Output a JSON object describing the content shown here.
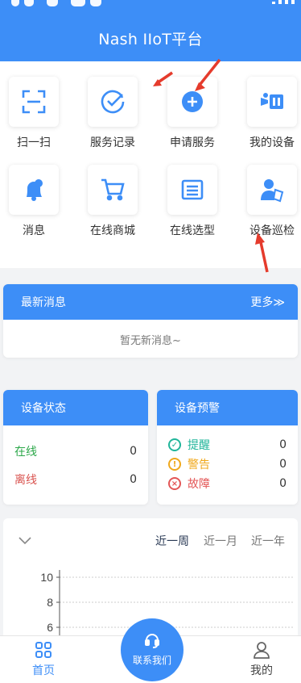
{
  "header": {
    "title": "Nash IIoT平台"
  },
  "colors": {
    "primary": "#3d8ef7",
    "online": "#2ca84a",
    "offline": "#d9534f",
    "remind": "#20b59a",
    "warn": "#f0a81c",
    "fault": "#e35656"
  },
  "quick_actions": [
    {
      "label": "扫一扫",
      "icon": "scan-icon"
    },
    {
      "label": "服务记录",
      "icon": "check-circle-icon"
    },
    {
      "label": "申请服务",
      "icon": "plus-circle-icon"
    },
    {
      "label": "我的设备",
      "icon": "camera-icon"
    },
    {
      "label": "消息",
      "icon": "bell-icon"
    },
    {
      "label": "在线商城",
      "icon": "cart-icon"
    },
    {
      "label": "在线选型",
      "icon": "list-icon"
    },
    {
      "label": "设备巡检",
      "icon": "inspector-icon"
    }
  ],
  "messages": {
    "title": "最新消息",
    "more": "更多≫",
    "empty": "暂无新消息~"
  },
  "device_status": {
    "title": "设备状态",
    "online_label": "在线",
    "online_value": "0",
    "offline_label": "离线",
    "offline_value": "0"
  },
  "device_alert": {
    "title": "设备预警",
    "remind_label": "提醒",
    "remind_value": "0",
    "warn_label": "警告",
    "warn_value": "0",
    "fault_label": "故障",
    "fault_value": "0"
  },
  "chart": {
    "tabs": [
      "近一周",
      "近一月",
      "近一年"
    ],
    "active_tab": "近一周",
    "visible_ticks": [
      "10",
      "8",
      "6"
    ]
  },
  "chart_data": {
    "type": "line",
    "y_ticks": [
      10,
      8,
      6
    ],
    "series": []
  },
  "tabbar": {
    "home": "首页",
    "contact": "联系我们",
    "mine": "我的"
  }
}
